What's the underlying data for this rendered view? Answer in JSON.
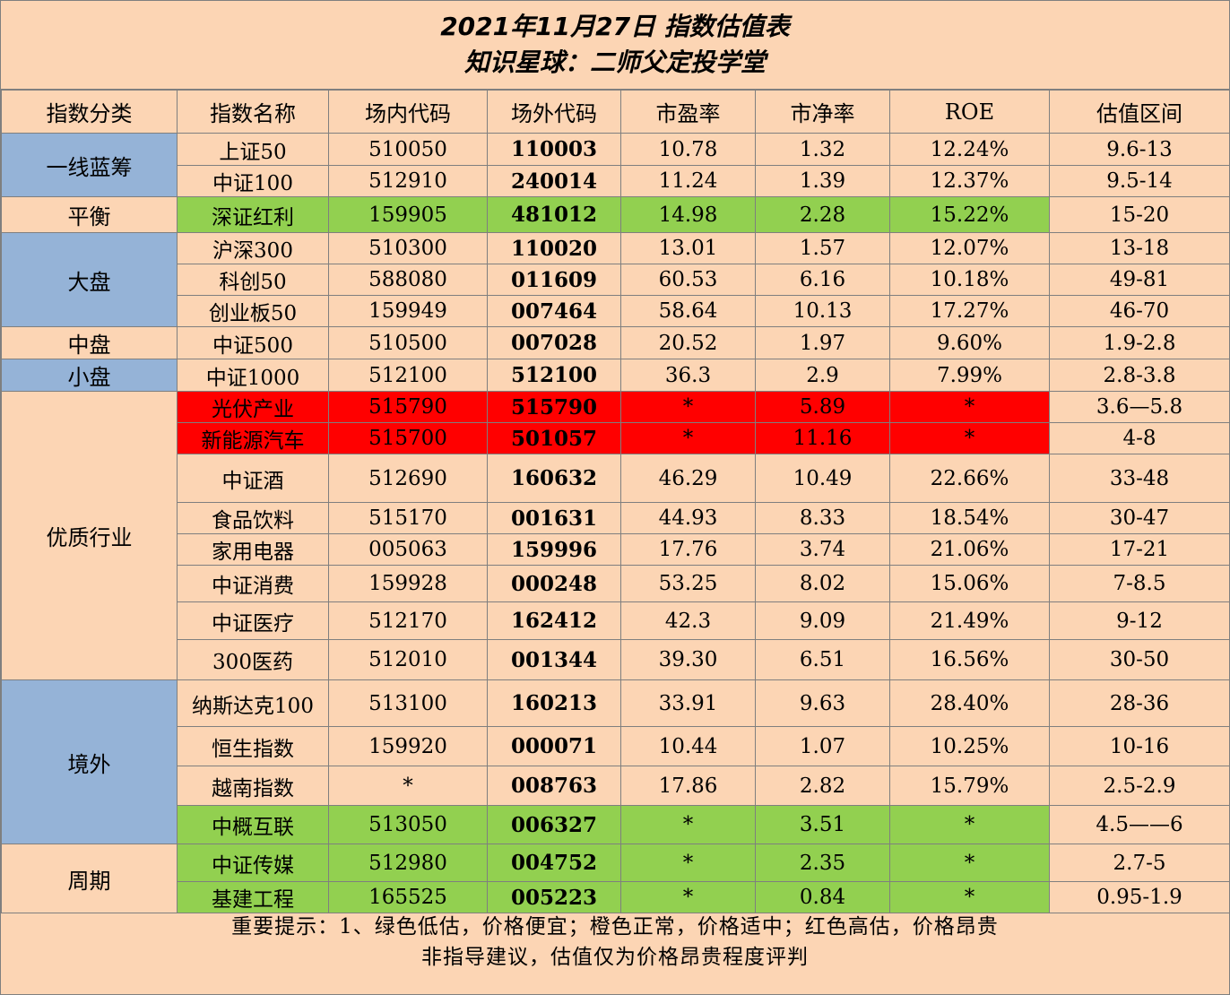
{
  "title": {
    "line1": "2021年11月27日 指数估值表",
    "line2": "知识星球：二师父定投学堂"
  },
  "headers": [
    "指数分类",
    "指数名称",
    "场内代码",
    "场外代码",
    "市盈率",
    "市净率",
    "ROE",
    "估值区间"
  ],
  "colors": {
    "background": "#fcd5b4",
    "category_blue": "#95b3d7",
    "undervalued_green": "#92d050",
    "overvalued_red": "#ff0000"
  },
  "groups": [
    {
      "category": "一线蓝筹",
      "cat_style": "blue",
      "rows": [
        {
          "name": "上证50",
          "code_in": "510050",
          "code_out": "110003",
          "pe": "10.78",
          "pb": "1.32",
          "roe": "12.24%",
          "range": "9.6-13",
          "status": "normal"
        },
        {
          "name": "中证100",
          "code_in": "512910",
          "code_out": "240014",
          "pe": "11.24",
          "pb": "1.39",
          "roe": "12.37%",
          "range": "9.5-14",
          "status": "normal"
        }
      ]
    },
    {
      "category": "平衡",
      "cat_style": "normal",
      "rows": [
        {
          "name": "深证红利",
          "code_in": "159905",
          "code_out": "481012",
          "pe": "14.98",
          "pb": "2.28",
          "roe": "15.22%",
          "range": "15-20",
          "status": "low"
        }
      ]
    },
    {
      "category": "大盘",
      "cat_style": "blue",
      "rows": [
        {
          "name": "沪深300",
          "code_in": "510300",
          "code_out": "110020",
          "pe": "13.01",
          "pb": "1.57",
          "roe": "12.07%",
          "range": "13-18",
          "status": "normal"
        },
        {
          "name": "科创50",
          "code_in": "588080",
          "code_out": "011609",
          "pe": "60.53",
          "pb": "6.16",
          "roe": "10.18%",
          "range": "49-81",
          "status": "normal"
        },
        {
          "name": "创业板50",
          "code_in": "159949",
          "code_out": "007464",
          "pe": "58.64",
          "pb": "10.13",
          "roe": "17.27%",
          "range": "46-70",
          "status": "normal"
        }
      ]
    },
    {
      "category": "中盘",
      "cat_style": "normal",
      "rows": [
        {
          "name": "中证500",
          "code_in": "510500",
          "code_out": "007028",
          "pe": "20.52",
          "pb": "1.97",
          "roe": "9.60%",
          "range": "1.9-2.8",
          "status": "normal"
        }
      ]
    },
    {
      "category": "小盘",
      "cat_style": "blue",
      "rows": [
        {
          "name": "中证1000",
          "code_in": "512100",
          "code_out": "512100",
          "pe": "36.3",
          "pb": "2.9",
          "roe": "7.99%",
          "range": "2.8-3.8",
          "status": "normal"
        }
      ]
    },
    {
      "category": "优质行业",
      "cat_style": "normal",
      "rows": [
        {
          "name": "光伏产业",
          "code_in": "515790",
          "code_out": "515790",
          "pe": "*",
          "pb": "5.89",
          "roe": "*",
          "range": "3.6—5.8",
          "status": "high"
        },
        {
          "name": "新能源汽车",
          "code_in": "515700",
          "code_out": "501057",
          "pe": "*",
          "pb": "11.16",
          "roe": "*",
          "range": "4-8",
          "status": "high"
        },
        {
          "name": "中证酒",
          "code_in": "512690",
          "code_out": "160632",
          "pe": "46.29",
          "pb": "10.49",
          "roe": "22.66%",
          "range": "33-48",
          "status": "normal"
        },
        {
          "name": "食品饮料",
          "code_in": "515170",
          "code_out": "001631",
          "pe": "44.93",
          "pb": "8.33",
          "roe": "18.54%",
          "range": "30-47",
          "status": "normal"
        },
        {
          "name": "家用电器",
          "code_in": "005063",
          "code_out": "159996",
          "pe": "17.76",
          "pb": "3.74",
          "roe": "21.06%",
          "range": "17-21",
          "status": "normal"
        },
        {
          "name": "中证消费",
          "code_in": "159928",
          "code_out": "000248",
          "pe": "53.25",
          "pb": "8.02",
          "roe": "15.06%",
          "range": "7-8.5",
          "status": "normal"
        },
        {
          "name": "中证医疗",
          "code_in": "512170",
          "code_out": "162412",
          "pe": "42.3",
          "pb": "9.09",
          "roe": "21.49%",
          "range": "9-12",
          "status": "normal"
        },
        {
          "name": "300医药",
          "code_in": "512010",
          "code_out": "001344",
          "pe": "39.30",
          "pb": "6.51",
          "roe": "16.56%",
          "range": "30-50",
          "status": "normal"
        }
      ]
    },
    {
      "category": "境外",
      "cat_style": "blue",
      "rows": [
        {
          "name": "纳斯达克100",
          "code_in": "513100",
          "code_out": "160213",
          "pe": "33.91",
          "pb": "9.63",
          "roe": "28.40%",
          "range": "28-36",
          "status": "normal"
        },
        {
          "name": "恒生指数",
          "code_in": "159920",
          "code_out": "000071",
          "pe": "10.44",
          "pb": "1.07",
          "roe": "10.25%",
          "range": "10-16",
          "status": "normal"
        },
        {
          "name": "越南指数",
          "code_in": "*",
          "code_out": "008763",
          "pe": "17.86",
          "pb": "2.82",
          "roe": "15.79%",
          "range": "2.5-2.9",
          "status": "normal"
        },
        {
          "name": "中概互联",
          "code_in": "513050",
          "code_out": "006327",
          "pe": "*",
          "pb": "3.51",
          "roe": "*",
          "range": "4.5——6",
          "status": "low"
        }
      ]
    },
    {
      "category": "周期",
      "cat_style": "normal",
      "rows": [
        {
          "name": "中证传媒",
          "code_in": "512980",
          "code_out": "004752",
          "pe": "*",
          "pb": "2.35",
          "roe": "*",
          "range": "2.7-5",
          "status": "low"
        },
        {
          "name": "基建工程",
          "code_in": "165525",
          "code_out": "005223",
          "pe": "*",
          "pb": "0.84",
          "roe": "*",
          "range": "0.95-1.9",
          "status": "low"
        }
      ]
    }
  ],
  "note": {
    "line1": "重要提示：1、绿色低估，价格便宜；橙色正常，价格适中；红色高估，价格昂贵",
    "line2": "非指导建议，估值仅为价格昂贵程度评判"
  }
}
